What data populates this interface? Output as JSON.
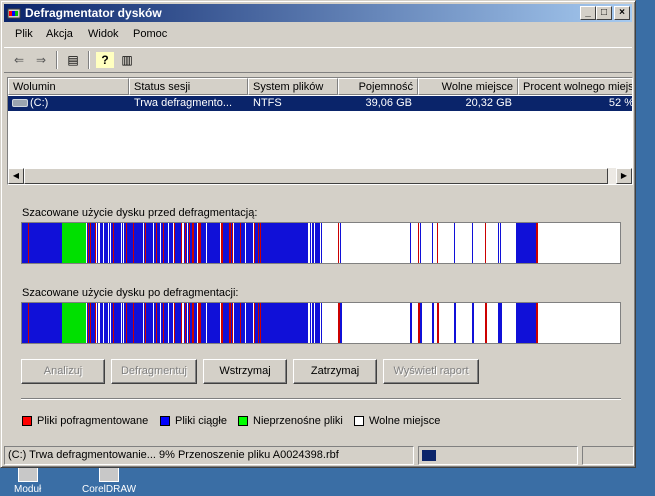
{
  "window": {
    "title": "Defragmentator dysków"
  },
  "titlebar_buttons": {
    "minimize": "_",
    "maximize": "□",
    "close": "×"
  },
  "menu": [
    "Plik",
    "Akcja",
    "Widok",
    "Pomoc"
  ],
  "toolbar": [
    {
      "icon": "back-arrow-icon",
      "glyph": "⇐",
      "enabled": false
    },
    {
      "icon": "forward-arrow-icon",
      "glyph": "⇒",
      "enabled": false
    },
    {
      "icon": "show-hide-tree-icon",
      "glyph": "▤",
      "enabled": true
    },
    {
      "icon": "help-icon",
      "glyph": "?",
      "enabled": true
    },
    {
      "icon": "console-icon",
      "glyph": "▥",
      "enabled": true
    }
  ],
  "table": {
    "columns": [
      "Wolumin",
      "Status sesji",
      "System plików",
      "Pojemność",
      "Wolne miejsce",
      "Procent wolnego miejsca"
    ],
    "rows": [
      {
        "volume": "(C:)",
        "status": "Trwa defragmento...",
        "fs": "NTFS",
        "capacity": "39,06 GB",
        "free": "20,32 GB",
        "percent": "52 %"
      }
    ]
  },
  "labels": {
    "before": "Szacowane użycie dysku przed defragmentacją:",
    "after": "Szacowane użycie dysku po defragmentacji:"
  },
  "buttons": [
    {
      "label": "Analizuj",
      "enabled": false
    },
    {
      "label": "Defragmentuj",
      "enabled": false
    },
    {
      "label": "Wstrzymaj",
      "enabled": true
    },
    {
      "label": "Zatrzymaj",
      "enabled": true
    },
    {
      "label": "Wyświetl raport",
      "enabled": false
    }
  ],
  "legend": [
    {
      "label": "Pliki pofragmentowane",
      "color": "#ff0000"
    },
    {
      "label": "Pliki ciągłe",
      "color": "#0000ff"
    },
    {
      "label": "Nieprzenośne pliki",
      "color": "#00ff00"
    },
    {
      "label": "Wolne miejsce",
      "color": "#ffffff"
    }
  ],
  "status": {
    "text": "(C:) Trwa defragmentowanie... 9%  Przenoszenie pliku A0024398.rbf",
    "progress": 0.09
  },
  "colors": {
    "fragmented": "#cc0000",
    "contiguous": "#1010d8",
    "unmovable": "#00e000",
    "free": "#ffffff",
    "selection": "#0a246a"
  },
  "desktop_icons": [
    {
      "label": "Moduł",
      "icon": "module-icon"
    },
    {
      "label": "CorelDRAW",
      "icon": "coreldraw-icon"
    }
  ]
}
